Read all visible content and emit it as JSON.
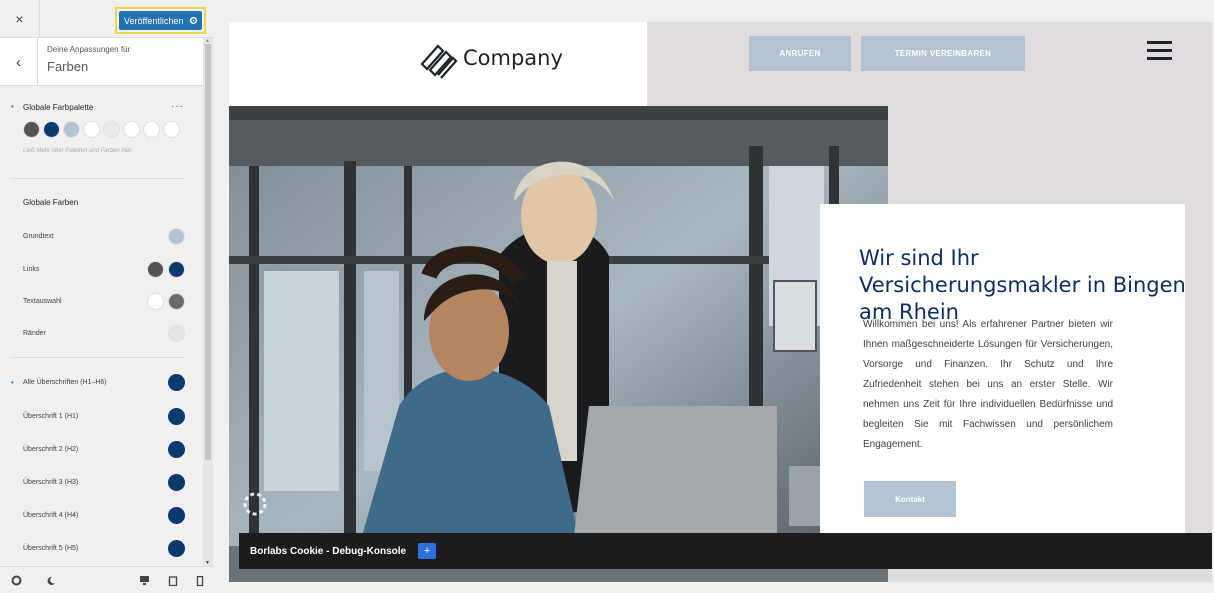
{
  "sidebar": {
    "close_label": "×",
    "publish_label": "Veröffentlichen",
    "back_label": "‹",
    "panel_subtitle": "Deine Anpassungen für",
    "panel_title": "Farben",
    "palette_title": "Globale Farbpalette",
    "palette_menu": "···",
    "palette_swatches": [
      "#545454",
      "#0b3a6f",
      "#b3c3d4",
      "#ffffff",
      "#e9e9e9",
      "#ffffff",
      "#ffffff",
      "#ffffff"
    ],
    "palette_hint": "Ließ Mehr über Paletten und Farben hier.",
    "global_colors_title": "Globale Farben",
    "rows": [
      {
        "label": "Grundtext",
        "colors": [
          "#b3c3d4"
        ]
      },
      {
        "label": "Links",
        "colors": [
          "#545454",
          "#0b3a6f"
        ]
      },
      {
        "label": "Textauswahl",
        "colors": [
          "#ffffff",
          "#6a6a6a"
        ]
      },
      {
        "label": "Ränder",
        "colors": [
          "#e6e2e5"
        ]
      }
    ],
    "headings": [
      {
        "label": "Alle Überschriften (H1–H6)",
        "color": "#0b3a6f"
      },
      {
        "label": "Überschrift 1 (H1)",
        "color": "#0b3a6f"
      },
      {
        "label": "Überschrift 2 (H2)",
        "color": "#0b3a6f"
      },
      {
        "label": "Überschrift 3 (H3)",
        "color": "#0b3a6f"
      },
      {
        "label": "Überschrift 4 (H4)",
        "color": "#0b3a6f"
      },
      {
        "label": "Überschrift 5 (H5)",
        "color": "#0b3a6f"
      }
    ],
    "bottom_icons": [
      "settings-icon",
      "dark-mode-icon",
      "desktop-icon",
      "tablet-icon",
      "mobile-icon"
    ]
  },
  "preview": {
    "logo_text": "Company",
    "call_button": "ANRUFEN",
    "appointment_button": "TERMIN VEREINBAREN",
    "hero_title": "Wir sind Ihr Versicherungsmakler in Bingen am Rhein",
    "hero_text": "Willkommen bei uns! Als erfahrener Partner bieten wir Ihnen maßgeschneiderte Lösungen für Versicherungen, Vorsorge und Finanzen. Ihr Schutz und Ihre Zufriedenheit stehen bei uns an erster Stelle. Wir nehmen uns Zeit für Ihre individuellen Bedürfnisse und begleiten Sie mit Fachwissen und persönlichem Engagement.",
    "contact_button": "Kontakt",
    "debug_label": "Borlabs Cookie - Debug-Konsole",
    "debug_plus": "+"
  },
  "colors": {
    "brand_dark": "#0b3060",
    "button_light": "#b3c3d4",
    "publish_blue": "#2271b1",
    "highlight_yellow": "#ecd64a"
  }
}
